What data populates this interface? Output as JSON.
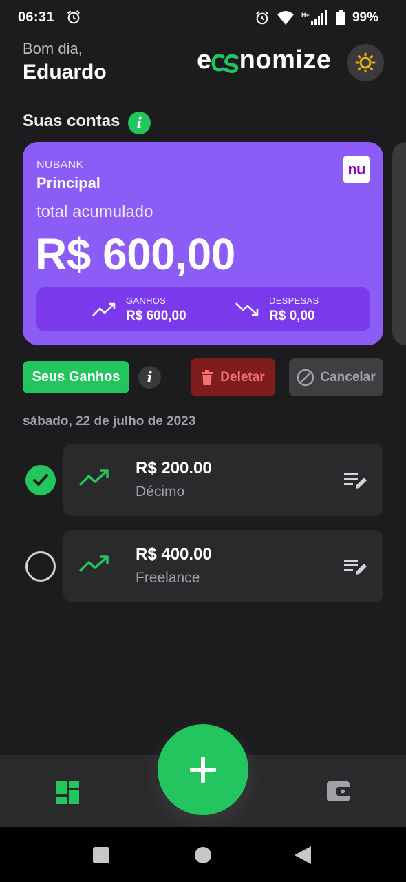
{
  "status_bar": {
    "time": "06:31",
    "battery_percent": "99%",
    "network_label": "H+",
    "icons": [
      "alarm-icon",
      "alarm-icon",
      "wifi-icon",
      "cell-signal-icon",
      "battery-icon"
    ]
  },
  "header": {
    "greeting": "Bom dia,",
    "user_name": "Eduardo",
    "logo_prefix": "e",
    "logo_suffix": "nomize",
    "theme_toggle_icon": "sun-icon"
  },
  "accounts": {
    "section_title": "Suas contas",
    "info_icon_text": "i",
    "card": {
      "bank": "NUBANK",
      "name": "Principal",
      "bank_logo_text": "nu",
      "total_label": "total acumulado",
      "total_value": "R$ 600,00",
      "income_label": "GANHOS",
      "income_value": "R$ 600,00",
      "expense_label": "DESPESAS",
      "expense_value": "R$ 0,00"
    }
  },
  "actions": {
    "gains_label": "Seus Ganhos",
    "info_icon_text": "i",
    "delete_label": "Deletar",
    "cancel_label": "Cancelar"
  },
  "date_header": "sábado, 22 de julho de 2023",
  "transactions": [
    {
      "amount": "R$ 200.00",
      "description": "Décimo",
      "selected": true
    },
    {
      "amount": "R$ 400.00",
      "description": "Freelance",
      "selected": false
    }
  ],
  "bottom_nav": {
    "items": [
      "dashboard-icon",
      "wallet-icon"
    ],
    "fab_icon": "plus-icon"
  },
  "colors": {
    "accent_green": "#22c55e",
    "card_purple": "#8b5cf6",
    "card_summary_purple": "#7c3aed",
    "delete_red_bg": "#7f1d1d",
    "delete_red_text": "#f87171",
    "background": "#1c1c1e",
    "surface": "#2a2a2c",
    "theme_icon_yellow": "#eab308"
  }
}
